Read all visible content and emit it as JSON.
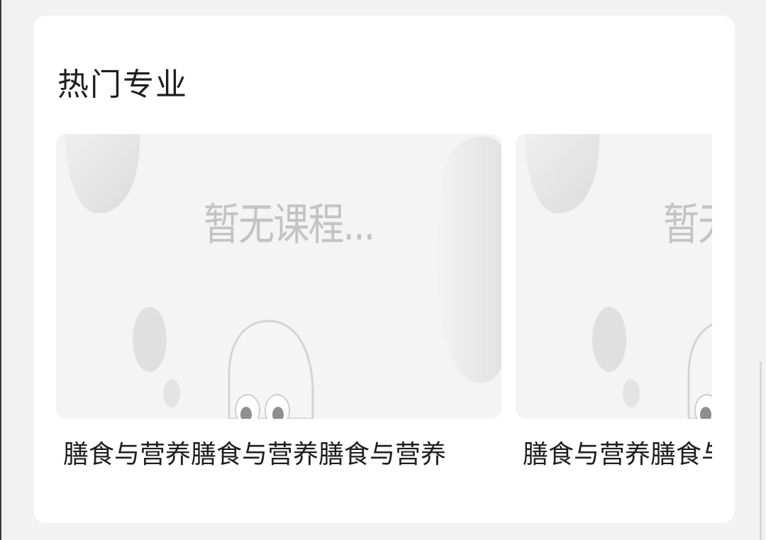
{
  "section": {
    "title": "热门专业"
  },
  "courses": [
    {
      "placeholder": "暂无课程...",
      "title": "膳食与营养膳食与营养膳食与营养"
    },
    {
      "placeholder": "暂无课程...",
      "title": "膳食与营养膳食与营养膳食与营养"
    }
  ],
  "colors": {
    "page_background": "#f2f2f2",
    "card_background": "#ffffff",
    "thumbnail_background": "#f4f4f4",
    "placeholder_text": "#c3c3c3",
    "title_text": "#1e1e1e"
  }
}
